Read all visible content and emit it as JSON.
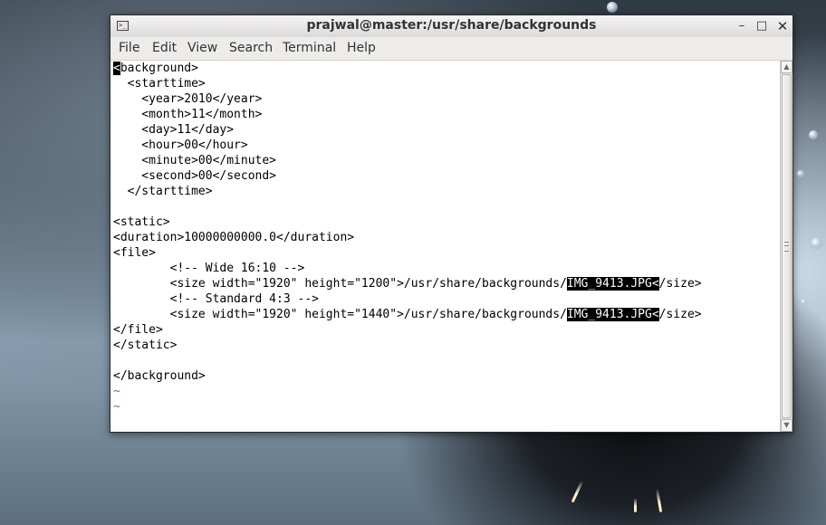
{
  "window": {
    "title": "prajwal@master:/usr/share/backgrounds",
    "icons": {
      "terminal": "terminal-icon",
      "minimize": "minimize-icon",
      "maximize": "maximize-icon",
      "close": "close-icon"
    },
    "controls": {
      "minimize": "–",
      "maximize": "□",
      "close": "✕"
    }
  },
  "menu": {
    "items": [
      "File",
      "Edit",
      "View",
      "Search",
      "Terminal",
      "Help"
    ]
  },
  "terminal": {
    "lines": [
      "background>",
      "  <starttime>",
      "    <year>2010</year>",
      "    <month>11</month>",
      "    <day>11</day>",
      "    <hour>00</hour>",
      "    <minute>00</minute>",
      "    <second>00</second>",
      "  </starttime>",
      "",
      "<static>",
      "<duration>10000000000.0</duration>",
      "<file>",
      "        <!-- Wide 16:10 -->",
      "        <size width=\"1920\" height=\"1200\">/usr/share/backgrounds/",
      "        <!-- Standard 4:3 -->",
      "        <size width=\"1920\" height=\"1440\">/usr/share/backgrounds/",
      "</file>",
      "</static>",
      "",
      "</background>",
      "~",
      "~"
    ],
    "cursor_char": "<",
    "highlighted": [
      "IMG_9413.JPG<",
      "IMG_9413.JPG<"
    ],
    "line_tails": [
      "/size>",
      "/size>"
    ],
    "colors": {
      "background": "#ffffff",
      "foreground": "#000000",
      "tilde": "#4a74d9",
      "selection": "#000000"
    }
  },
  "scrollbar": {
    "up_arrow": "▲",
    "down_arrow": "▼"
  }
}
